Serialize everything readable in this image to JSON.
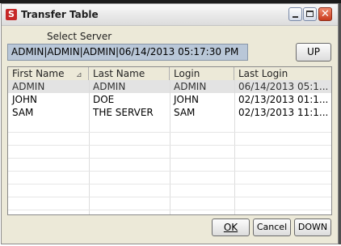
{
  "window": {
    "title": "Transfer Table",
    "app_icon_letter": "S"
  },
  "select_server": {
    "label": "Select Server",
    "value": "ADMIN|ADMIN|ADMIN|06/14/2013 05:17:30 PM",
    "up_label": "UP"
  },
  "table": {
    "columns": [
      "First Name",
      "Last Name",
      "Login",
      "Last Login"
    ],
    "rows": [
      [
        "ADMIN",
        "ADMIN",
        "ADMIN",
        "06/14/2013 05:1..."
      ],
      [
        "JOHN",
        "DOE",
        "JOHN",
        "02/13/2013 01:1..."
      ],
      [
        "SAM",
        "THE SERVER",
        "SAM",
        "02/13/2013 11:1..."
      ]
    ],
    "selected_row": 0
  },
  "footer": {
    "ok_label": "OK",
    "cancel_label": "Cancel",
    "down_label": "DOWN"
  }
}
